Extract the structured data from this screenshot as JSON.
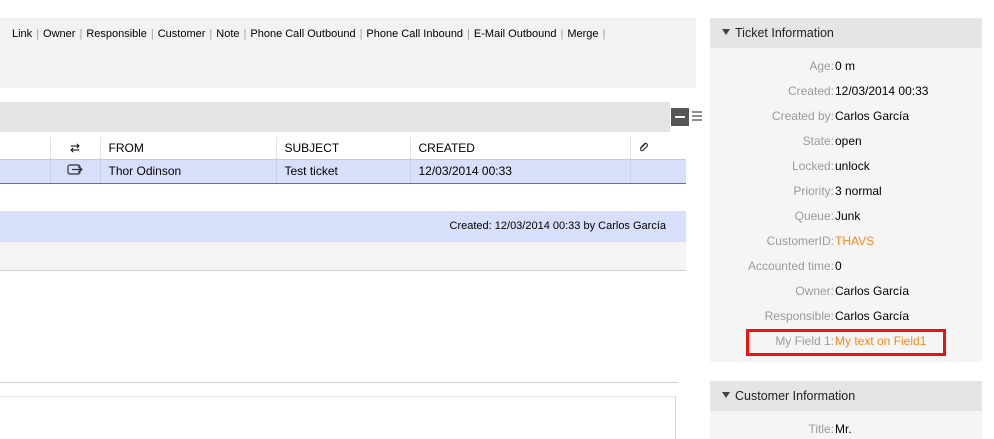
{
  "menu": {
    "items": [
      "Link",
      "Owner",
      "Responsible",
      "Customer",
      "Note",
      "Phone Call Outbound",
      "Phone Call Inbound",
      "E-Mail Outbound",
      "Merge"
    ]
  },
  "articles_table": {
    "headers": [
      "",
      "⇄",
      "FROM",
      "SUBJECT",
      "CREATED",
      ""
    ],
    "rows": [
      {
        "direction_icon": "incoming-icon",
        "from": "Thor Odinson",
        "subject": "Test ticket",
        "created": "12/03/2014 00:33",
        "attachment": ""
      }
    ],
    "attachment_header_icon": "paperclip-icon"
  },
  "article_info": {
    "created_text": "Created: 12/03/2014 00:33 by Carlos García"
  },
  "ticket_information": {
    "title": "Ticket Information",
    "fields": [
      {
        "label": "Age:",
        "value": "0 m"
      },
      {
        "label": "Created:",
        "value": "12/03/2014 00:33"
      },
      {
        "label": "Created by:",
        "value": "Carlos García"
      },
      {
        "label": "State:",
        "value": "open"
      },
      {
        "label": "Locked:",
        "value": "unlock"
      },
      {
        "label": "Priority:",
        "value": "3 normal"
      },
      {
        "label": "Queue:",
        "value": "Junk"
      },
      {
        "label": "CustomerID:",
        "value": "THAVS"
      },
      {
        "label": "Accounted time:",
        "value": "0"
      },
      {
        "label": "Owner:",
        "value": "Carlos García"
      },
      {
        "label": "Responsible:",
        "value": "Carlos García"
      },
      {
        "label": "My Field 1:",
        "value": "My text on Field1"
      }
    ]
  },
  "customer_information": {
    "title": "Customer Information",
    "fields": [
      {
        "label": "Title:",
        "value": "Mr."
      }
    ]
  },
  "colors": {
    "link": "#f28b1e",
    "selected_row": "#d8dffa",
    "highlight_border": "#ee1111"
  }
}
